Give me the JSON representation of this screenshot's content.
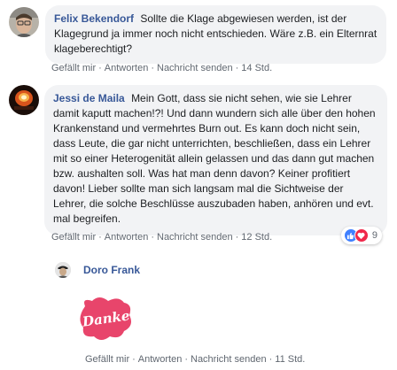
{
  "comments": [
    {
      "author": "Felix Bekendorf",
      "text": "Sollte die Klage abgewiesen werden, ist der Klagegrund ja immer noch nicht entschieden. Wäre z.B. ein Elternrat klageberechtigt?",
      "actions": {
        "like": "Gefällt mir",
        "reply": "Antworten",
        "message": "Nachricht senden",
        "time": "14 Std."
      }
    },
    {
      "author": "Jessi de Maila",
      "text": "Mein Gott, dass sie nicht sehen, wie sie Lehrer damit kaputt machen!?! Und dann wundern sich alle über den hohen Krankenstand und vermehrtes Burn out. Es kann doch nicht sein, dass Leute, die gar nicht unterrichten, beschließen, dass ein Lehrer mit so einer Heterogenität allein gelassen und das dann gut machen bzw. aushalten soll. Was hat man denn davon? Keiner profitiert davon! Lieber sollte man sich langsam mal die Sichtweise der Lehrer, die solche Beschlüsse auszubaden haben, anhören und evt. mal begreifen.",
      "reactions": {
        "count": "9",
        "types": [
          "like-icon",
          "love-icon"
        ],
        "like_color": "#4080ff",
        "love_color": "#f0284a"
      },
      "actions": {
        "like": "Gefällt mir",
        "reply": "Antworten",
        "message": "Nachricht senden",
        "time": "12 Std."
      }
    },
    {
      "author": "Doro Frank",
      "sticker_text": "Danke",
      "sticker_color": "#e8456b",
      "actions": {
        "like": "Gefällt mir",
        "reply": "Antworten",
        "message": "Nachricht senden",
        "time": "11 Std."
      }
    }
  ],
  "separator": "·",
  "colors": {
    "link": "#385898",
    "bubble": "#f2f3f5",
    "meta": "#606770"
  }
}
